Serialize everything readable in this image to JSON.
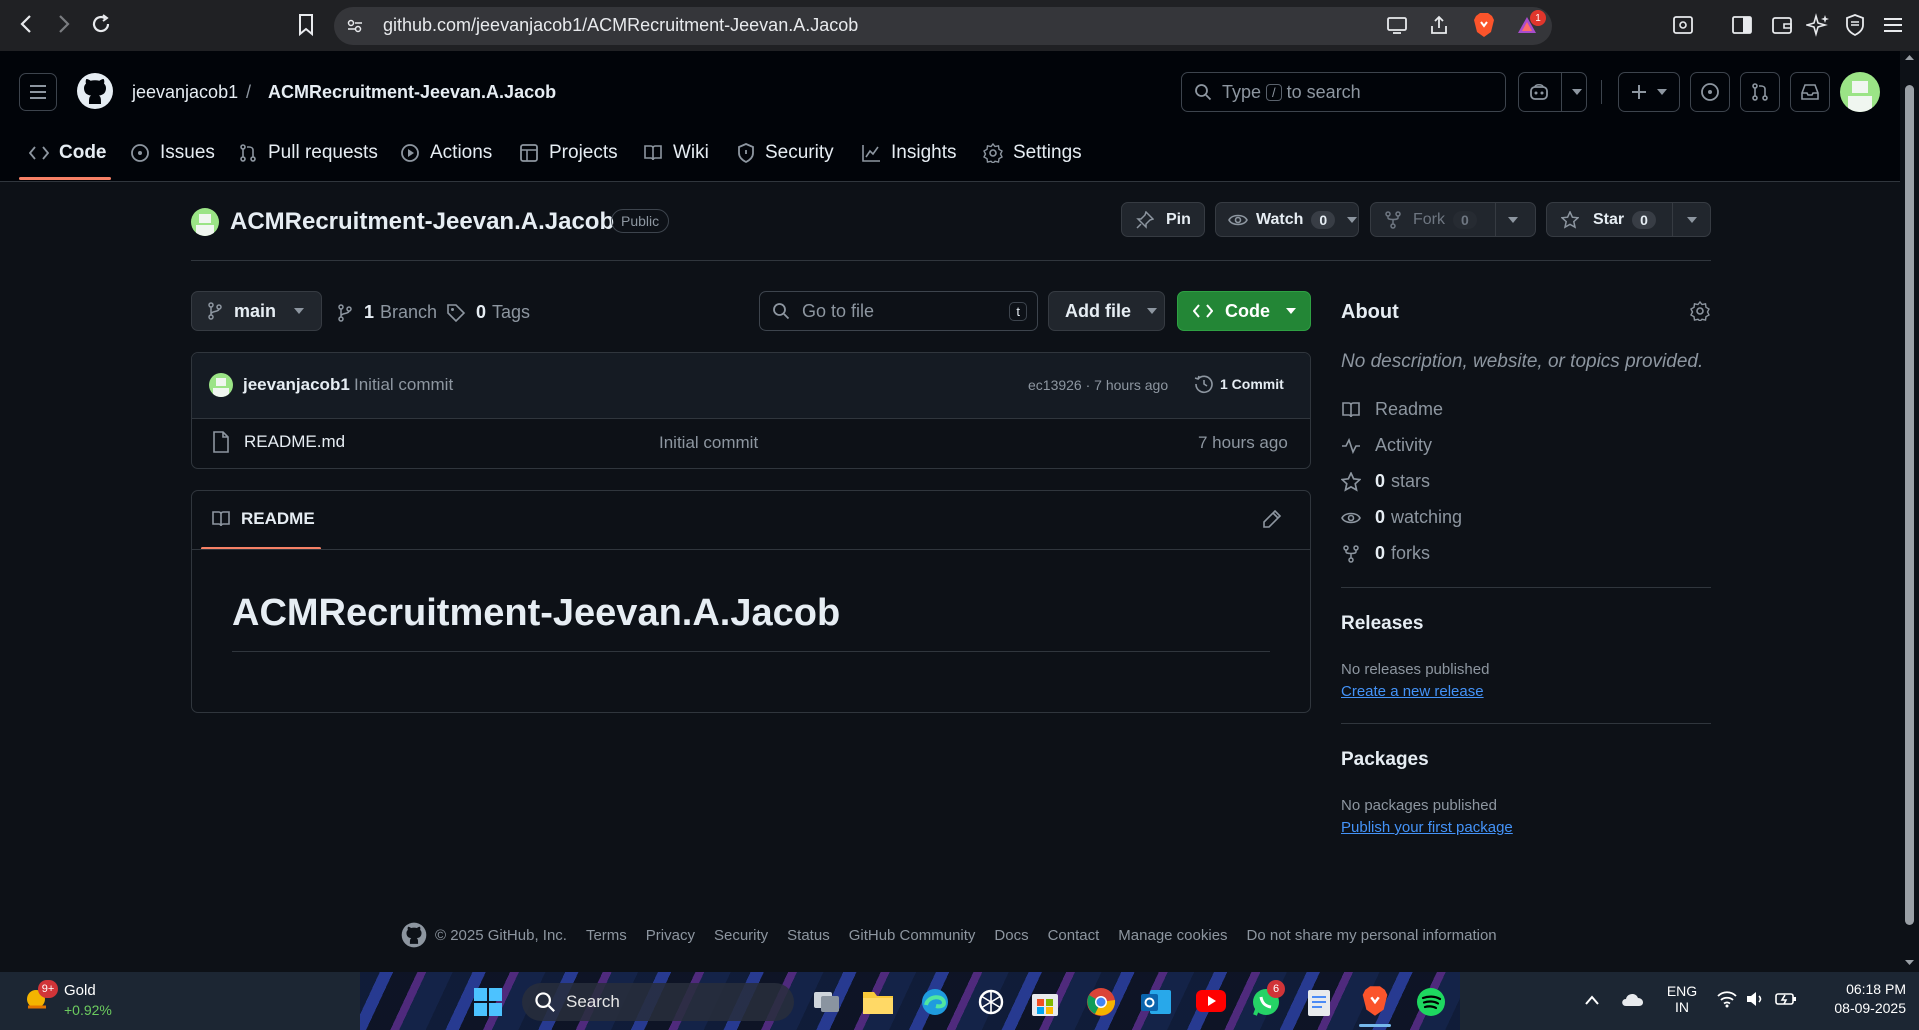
{
  "browser": {
    "url": "github.com/jeevanjacob1/ACMRecruitment-Jeevan.A.Jacob",
    "notification_count": "1"
  },
  "header": {
    "owner": "jeevanjacob1",
    "separator": "/",
    "repo": "ACMRecruitment-Jeevan.A.Jacob",
    "search_prefix": "Type",
    "search_key": "/",
    "search_suffix": "to search"
  },
  "tabs": [
    {
      "label": "Code",
      "icon": "code-icon",
      "selected": true
    },
    {
      "label": "Issues",
      "icon": "issue-icon"
    },
    {
      "label": "Pull requests",
      "icon": "pull-request-icon"
    },
    {
      "label": "Actions",
      "icon": "play-icon"
    },
    {
      "label": "Projects",
      "icon": "table-icon"
    },
    {
      "label": "Wiki",
      "icon": "book-icon"
    },
    {
      "label": "Security",
      "icon": "shield-icon"
    },
    {
      "label": "Insights",
      "icon": "graph-icon"
    },
    {
      "label": "Settings",
      "icon": "gear-icon"
    }
  ],
  "repo_header": {
    "name": "ACMRecruitment-Jeevan.A.Jacob",
    "visibility": "Public",
    "pin_label": "Pin",
    "watch_label": "Watch",
    "watch_count": "0",
    "fork_label": "Fork",
    "fork_count": "0",
    "star_label": "Star",
    "star_count": "0"
  },
  "file_nav": {
    "branch": "main",
    "branch_count": "1",
    "branch_label": "Branch",
    "tag_count": "0",
    "tag_label": "Tags",
    "goto_placeholder": "Go to file",
    "goto_key": "t",
    "add_file_label": "Add file",
    "code_label": "Code"
  },
  "latest_commit": {
    "author": "jeevanjacob1",
    "message": "Initial commit",
    "meta": "ec13926 · 7 hours ago",
    "count_label": "1 Commit"
  },
  "files": [
    {
      "name": "README.md",
      "message": "Initial commit",
      "time": "7 hours ago"
    }
  ],
  "readme": {
    "tab_label": "README",
    "heading": "ACMRecruitment-Jeevan.A.Jacob"
  },
  "about": {
    "title": "About",
    "description": "No description, website, or topics provided.",
    "readme": "Readme",
    "activity": "Activity",
    "stars_count": "0",
    "stars_label": "stars",
    "watching_count": "0",
    "watching_label": "watching",
    "forks_count": "0",
    "forks_label": "forks"
  },
  "releases": {
    "title": "Releases",
    "empty": "No releases published",
    "link": "Create a new release"
  },
  "packages": {
    "title": "Packages",
    "empty": "No packages published",
    "link": "Publish your first package"
  },
  "footer": {
    "copyright": "© 2025 GitHub, Inc.",
    "links": [
      "Terms",
      "Privacy",
      "Security",
      "Status",
      "GitHub Community",
      "Docs",
      "Contact",
      "Manage cookies",
      "Do not share my personal information"
    ]
  },
  "taskbar": {
    "weather_badge": "9+",
    "weather_title": "Gold",
    "weather_change": "+0.92%",
    "search_label": "Search",
    "whatsapp_badge": "6",
    "lang_top": "ENG",
    "lang_bottom": "IN",
    "time": "06:18 PM",
    "date": "08-09-2025"
  },
  "colors": {
    "bg": "#0d1117",
    "header_bg": "#010409",
    "border": "#30363d",
    "green": "#238636",
    "link": "#4493f8",
    "tab_underline": "#f78166"
  }
}
